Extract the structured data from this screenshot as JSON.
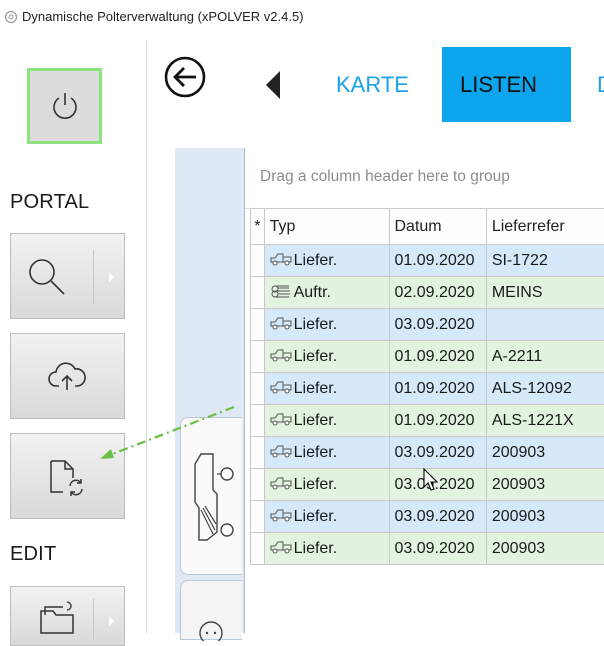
{
  "window": {
    "title": "Dynamische Polterverwaltung (xPOLVER v2.4.5)"
  },
  "sidebar": {
    "portal_label": "PORTAL",
    "edit_label": "EDIT",
    "buttons": [
      "power-icon",
      "search-icon",
      "cloud-upload-icon",
      "file-sync-icon",
      "folder-edit-icon"
    ]
  },
  "nav": {
    "tabs": [
      {
        "label": "KARTE",
        "active": false
      },
      {
        "label": "LISTEN",
        "active": true
      },
      {
        "label": "D",
        "active": false
      }
    ],
    "accent_color": "#0ea5ef"
  },
  "grid": {
    "group_hint": "Drag a column header here to group",
    "columns": [
      "Typ",
      "Datum",
      "Lieferrefer"
    ],
    "row_indicator": "*",
    "rows": [
      {
        "icon": "truck-icon",
        "typ": "Liefer.",
        "datum": "01.09.2020",
        "ref": "SI-1722",
        "color": "blue"
      },
      {
        "icon": "logs-icon",
        "typ": "Auftr.",
        "datum": "02.09.2020",
        "ref": "MEINS",
        "color": "green"
      },
      {
        "icon": "truck-icon",
        "typ": "Liefer.",
        "datum": "03.09.2020",
        "ref": "",
        "color": "blue"
      },
      {
        "icon": "truck-icon",
        "typ": "Liefer.",
        "datum": "01.09.2020",
        "ref": "A-2211",
        "color": "green"
      },
      {
        "icon": "truck-icon",
        "typ": "Liefer.",
        "datum": "01.09.2020",
        "ref": "ALS-12092",
        "color": "blue"
      },
      {
        "icon": "truck-icon",
        "typ": "Liefer.",
        "datum": "01.09.2020",
        "ref": "ALS-1221X",
        "color": "green"
      },
      {
        "icon": "truck-icon",
        "typ": "Liefer.",
        "datum": "03.09.2020",
        "ref": "200903",
        "color": "blue"
      },
      {
        "icon": "truck-icon",
        "typ": "Liefer.",
        "datum": "03.09.2020",
        "ref": "200903",
        "color": "green"
      },
      {
        "icon": "truck-icon",
        "typ": "Liefer.",
        "datum": "03.09.2020",
        "ref": "200903",
        "color": "blue"
      },
      {
        "icon": "truck-icon",
        "typ": "Liefer.",
        "datum": "03.09.2020",
        "ref": "200903",
        "color": "green"
      }
    ]
  }
}
